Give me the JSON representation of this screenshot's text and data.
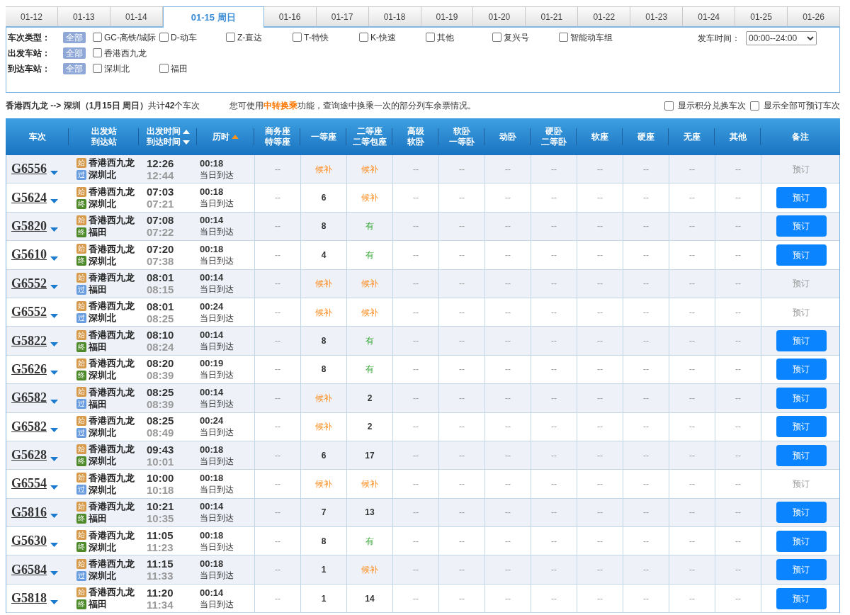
{
  "date_tabs": [
    {
      "label": "01-12",
      "selected": false
    },
    {
      "label": "01-13",
      "selected": false
    },
    {
      "label": "01-14",
      "selected": false
    },
    {
      "label": "01-15 周日",
      "selected": true
    },
    {
      "label": "01-16",
      "selected": false
    },
    {
      "label": "01-17",
      "selected": false
    },
    {
      "label": "01-18",
      "selected": false
    },
    {
      "label": "01-19",
      "selected": false
    },
    {
      "label": "01-20",
      "selected": false
    },
    {
      "label": "01-21",
      "selected": false
    },
    {
      "label": "01-22",
      "selected": false
    },
    {
      "label": "01-23",
      "selected": false
    },
    {
      "label": "01-24",
      "selected": false
    },
    {
      "label": "01-25",
      "selected": false
    },
    {
      "label": "01-26",
      "selected": false
    }
  ],
  "filters": [
    {
      "label": "车次类型：",
      "all": "全部",
      "options": [
        {
          "label": "GC-高铁/城际",
          "checked": false
        },
        {
          "label": "D-动车",
          "checked": false
        },
        {
          "label": "Z-直达",
          "checked": false
        },
        {
          "label": "T-特快",
          "checked": false
        },
        {
          "label": "K-快速",
          "checked": false
        },
        {
          "label": "其他",
          "checked": false
        },
        {
          "label": "复兴号",
          "checked": false
        },
        {
          "label": "智能动车组",
          "checked": false
        }
      ]
    },
    {
      "label": "出发车站：",
      "all": "全部",
      "options": [
        {
          "label": "香港西九龙",
          "checked": false
        }
      ]
    },
    {
      "label": "到达车站：",
      "all": "全部",
      "options": [
        {
          "label": "深圳北",
          "checked": false
        },
        {
          "label": "福田",
          "checked": false
        }
      ]
    }
  ],
  "depart_time": {
    "label": "发车时间：",
    "value": "00:00--24:00"
  },
  "summary": "**香港西九龙 --> 深圳（1月15日  周日）**共计**42**个车次",
  "notice": {
    "before": "您可使用",
    "link": "中转换乘",
    "after": "功能，查询途中换乘一次的部分列车余票情况。"
  },
  "display_options": [
    {
      "label": "显示积分兑换车次",
      "checked": false
    },
    {
      "label": "显示全部可预订车次",
      "checked": false
    }
  ],
  "columns": [
    {
      "lines": [
        "车次"
      ]
    },
    {
      "lines": [
        "出发站",
        "到达站"
      ]
    },
    {
      "lines": [
        "出发时间",
        "到达时间"
      ],
      "sort_icons": [
        {
          "kind": "up"
        },
        {
          "kind": "down"
        }
      ],
      "active_sort": false
    },
    {
      "lines": [
        "历时"
      ],
      "sort_icons": [
        {
          "kind": "up"
        }
      ],
      "active_sort": true
    },
    {
      "lines": [
        "商务座",
        "特等座"
      ]
    },
    {
      "lines": [
        "一等座"
      ]
    },
    {
      "lines": [
        "二等座",
        "二等包座"
      ]
    },
    {
      "lines": [
        "高级",
        "软卧"
      ]
    },
    {
      "lines": [
        "软卧",
        "一等卧"
      ]
    },
    {
      "lines": [
        "动卧"
      ]
    },
    {
      "lines": [
        "硬卧",
        "二等卧"
      ]
    },
    {
      "lines": [
        "软座"
      ]
    },
    {
      "lines": [
        "硬座"
      ]
    },
    {
      "lines": [
        "无座"
      ]
    },
    {
      "lines": [
        "其他"
      ]
    },
    {
      "lines": [
        "备注"
      ]
    }
  ],
  "trains": [
    {
      "train": "G6556",
      "from": {
        "badge": "始",
        "kind": "start",
        "name": "香港西九龙"
      },
      "to": {
        "badge": "过",
        "kind": "pass",
        "name": "深圳北"
      },
      "depart": "12:26",
      "arrive": "12:44",
      "duration": "00:18",
      "arrival_day": "当日到达",
      "seats": [
        "--",
        {
          "text": "候补",
          "kind": "waitlist"
        },
        {
          "text": "候补",
          "kind": "waitlist"
        },
        "--",
        "--",
        "--",
        "--",
        "--",
        "--",
        "--",
        "--"
      ],
      "action": {
        "label": "预订",
        "enabled": false
      }
    },
    {
      "train": "G5624",
      "from": {
        "badge": "始",
        "kind": "start",
        "name": "香港西九龙"
      },
      "to": {
        "badge": "终",
        "kind": "end",
        "name": "深圳北"
      },
      "depart": "07:03",
      "arrive": "07:21",
      "duration": "00:18",
      "arrival_day": "当日到达",
      "seats": [
        "--",
        {
          "text": "6",
          "kind": "count"
        },
        {
          "text": "候补",
          "kind": "waitlist"
        },
        "--",
        "--",
        "--",
        "--",
        "--",
        "--",
        "--",
        "--"
      ],
      "action": {
        "label": "预订",
        "enabled": true
      }
    },
    {
      "train": "G5820",
      "from": {
        "badge": "始",
        "kind": "start",
        "name": "香港西九龙"
      },
      "to": {
        "badge": "终",
        "kind": "end",
        "name": "福田"
      },
      "depart": "07:08",
      "arrive": "07:22",
      "duration": "00:14",
      "arrival_day": "当日到达",
      "seats": [
        "--",
        {
          "text": "8",
          "kind": "count"
        },
        {
          "text": "有",
          "kind": "available"
        },
        "--",
        "--",
        "--",
        "--",
        "--",
        "--",
        "--",
        "--"
      ],
      "action": {
        "label": "预订",
        "enabled": true
      }
    },
    {
      "train": "G5610",
      "from": {
        "badge": "始",
        "kind": "start",
        "name": "香港西九龙"
      },
      "to": {
        "badge": "终",
        "kind": "end",
        "name": "深圳北"
      },
      "depart": "07:20",
      "arrive": "07:38",
      "duration": "00:18",
      "arrival_day": "当日到达",
      "seats": [
        "--",
        {
          "text": "4",
          "kind": "count"
        },
        {
          "text": "有",
          "kind": "available"
        },
        "--",
        "--",
        "--",
        "--",
        "--",
        "--",
        "--",
        "--"
      ],
      "action": {
        "label": "预订",
        "enabled": true
      }
    },
    {
      "train": "G6552",
      "from": {
        "badge": "始",
        "kind": "start",
        "name": "香港西九龙"
      },
      "to": {
        "badge": "过",
        "kind": "pass",
        "name": "福田"
      },
      "depart": "08:01",
      "arrive": "08:15",
      "duration": "00:14",
      "arrival_day": "当日到达",
      "seats": [
        "--",
        {
          "text": "候补",
          "kind": "waitlist"
        },
        {
          "text": "候补",
          "kind": "waitlist"
        },
        "--",
        "--",
        "--",
        "--",
        "--",
        "--",
        "--",
        "--"
      ],
      "action": {
        "label": "预订",
        "enabled": false
      }
    },
    {
      "train": "G6552",
      "from": {
        "badge": "始",
        "kind": "start",
        "name": "香港西九龙"
      },
      "to": {
        "badge": "过",
        "kind": "pass",
        "name": "深圳北"
      },
      "depart": "08:01",
      "arrive": "08:25",
      "duration": "00:24",
      "arrival_day": "当日到达",
      "seats": [
        "--",
        {
          "text": "候补",
          "kind": "waitlist"
        },
        {
          "text": "候补",
          "kind": "waitlist"
        },
        "--",
        "--",
        "--",
        "--",
        "--",
        "--",
        "--",
        "--"
      ],
      "action": {
        "label": "预订",
        "enabled": false
      }
    },
    {
      "train": "G5822",
      "from": {
        "badge": "始",
        "kind": "start",
        "name": "香港西九龙"
      },
      "to": {
        "badge": "终",
        "kind": "end",
        "name": "福田"
      },
      "depart": "08:10",
      "arrive": "08:24",
      "duration": "00:14",
      "arrival_day": "当日到达",
      "seats": [
        "--",
        {
          "text": "8",
          "kind": "count"
        },
        {
          "text": "有",
          "kind": "available"
        },
        "--",
        "--",
        "--",
        "--",
        "--",
        "--",
        "--",
        "--"
      ],
      "action": {
        "label": "预订",
        "enabled": true
      }
    },
    {
      "train": "G5626",
      "from": {
        "badge": "始",
        "kind": "start",
        "name": "香港西九龙"
      },
      "to": {
        "badge": "终",
        "kind": "end",
        "name": "深圳北"
      },
      "depart": "08:20",
      "arrive": "08:39",
      "duration": "00:19",
      "arrival_day": "当日到达",
      "seats": [
        "--",
        {
          "text": "8",
          "kind": "count"
        },
        {
          "text": "有",
          "kind": "available"
        },
        "--",
        "--",
        "--",
        "--",
        "--",
        "--",
        "--",
        "--"
      ],
      "action": {
        "label": "预订",
        "enabled": true
      }
    },
    {
      "train": "G6582",
      "from": {
        "badge": "始",
        "kind": "start",
        "name": "香港西九龙"
      },
      "to": {
        "badge": "过",
        "kind": "pass",
        "name": "福田"
      },
      "depart": "08:25",
      "arrive": "08:39",
      "duration": "00:14",
      "arrival_day": "当日到达",
      "seats": [
        "--",
        {
          "text": "候补",
          "kind": "waitlist"
        },
        {
          "text": "2",
          "kind": "count"
        },
        "--",
        "--",
        "--",
        "--",
        "--",
        "--",
        "--",
        "--"
      ],
      "action": {
        "label": "预订",
        "enabled": true
      }
    },
    {
      "train": "G6582",
      "from": {
        "badge": "始",
        "kind": "start",
        "name": "香港西九龙"
      },
      "to": {
        "badge": "过",
        "kind": "pass",
        "name": "深圳北"
      },
      "depart": "08:25",
      "arrive": "08:49",
      "duration": "00:24",
      "arrival_day": "当日到达",
      "seats": [
        "--",
        {
          "text": "候补",
          "kind": "waitlist"
        },
        {
          "text": "2",
          "kind": "count"
        },
        "--",
        "--",
        "--",
        "--",
        "--",
        "--",
        "--",
        "--"
      ],
      "action": {
        "label": "预订",
        "enabled": true
      }
    },
    {
      "train": "G5628",
      "from": {
        "badge": "始",
        "kind": "start",
        "name": "香港西九龙"
      },
      "to": {
        "badge": "终",
        "kind": "end",
        "name": "深圳北"
      },
      "depart": "09:43",
      "arrive": "10:01",
      "duration": "00:18",
      "arrival_day": "当日到达",
      "seats": [
        "--",
        {
          "text": "6",
          "kind": "count"
        },
        {
          "text": "17",
          "kind": "count"
        },
        "--",
        "--",
        "--",
        "--",
        "--",
        "--",
        "--",
        "--"
      ],
      "action": {
        "label": "预订",
        "enabled": true
      }
    },
    {
      "train": "G6554",
      "from": {
        "badge": "始",
        "kind": "start",
        "name": "香港西九龙"
      },
      "to": {
        "badge": "过",
        "kind": "pass",
        "name": "深圳北"
      },
      "depart": "10:00",
      "arrive": "10:18",
      "duration": "00:18",
      "arrival_day": "当日到达",
      "seats": [
        "--",
        {
          "text": "候补",
          "kind": "waitlist"
        },
        {
          "text": "候补",
          "kind": "waitlist"
        },
        "--",
        "--",
        "--",
        "--",
        "--",
        "--",
        "--",
        "--"
      ],
      "action": {
        "label": "预订",
        "enabled": false
      }
    },
    {
      "train": "G5816",
      "from": {
        "badge": "始",
        "kind": "start",
        "name": "香港西九龙"
      },
      "to": {
        "badge": "终",
        "kind": "end",
        "name": "福田"
      },
      "depart": "10:21",
      "arrive": "10:35",
      "duration": "00:14",
      "arrival_day": "当日到达",
      "seats": [
        "--",
        {
          "text": "7",
          "kind": "count"
        },
        {
          "text": "13",
          "kind": "count"
        },
        "--",
        "--",
        "--",
        "--",
        "--",
        "--",
        "--",
        "--"
      ],
      "action": {
        "label": "预订",
        "enabled": true
      }
    },
    {
      "train": "G5630",
      "from": {
        "badge": "始",
        "kind": "start",
        "name": "香港西九龙"
      },
      "to": {
        "badge": "终",
        "kind": "end",
        "name": "深圳北"
      },
      "depart": "11:05",
      "arrive": "11:23",
      "duration": "00:18",
      "arrival_day": "当日到达",
      "seats": [
        "--",
        {
          "text": "8",
          "kind": "count"
        },
        {
          "text": "有",
          "kind": "available"
        },
        "--",
        "--",
        "--",
        "--",
        "--",
        "--",
        "--",
        "--"
      ],
      "action": {
        "label": "预订",
        "enabled": true
      }
    },
    {
      "train": "G6584",
      "from": {
        "badge": "始",
        "kind": "start",
        "name": "香港西九龙"
      },
      "to": {
        "badge": "过",
        "kind": "pass",
        "name": "深圳北"
      },
      "depart": "11:15",
      "arrive": "11:33",
      "duration": "00:18",
      "arrival_day": "当日到达",
      "seats": [
        "--",
        {
          "text": "1",
          "kind": "count"
        },
        {
          "text": "候补",
          "kind": "waitlist"
        },
        "--",
        "--",
        "--",
        "--",
        "--",
        "--",
        "--",
        "--"
      ],
      "action": {
        "label": "预订",
        "enabled": true
      }
    },
    {
      "train": "G5818",
      "from": {
        "badge": "始",
        "kind": "start",
        "name": "香港西九龙"
      },
      "to": {
        "badge": "终",
        "kind": "end",
        "name": "福田"
      },
      "depart": "11:20",
      "arrive": "11:34",
      "duration": "00:14",
      "arrival_day": "当日到达",
      "seats": [
        "--",
        {
          "text": "1",
          "kind": "count"
        },
        {
          "text": "14",
          "kind": "count"
        },
        "--",
        "--",
        "--",
        "--",
        "--",
        "--",
        "--",
        "--"
      ],
      "action": {
        "label": "预订",
        "enabled": true
      }
    }
  ]
}
